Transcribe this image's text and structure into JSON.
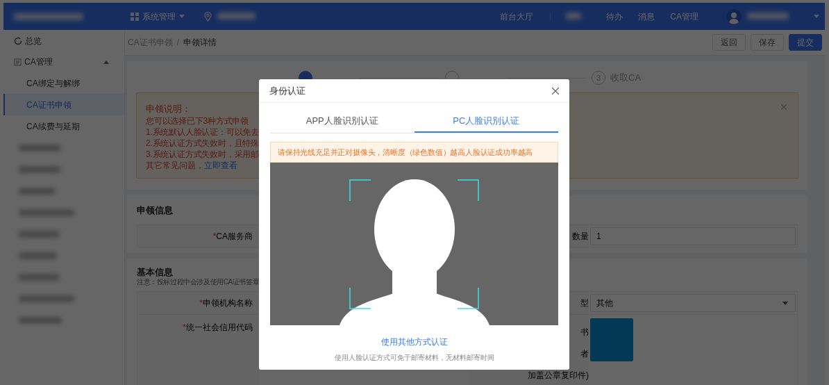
{
  "header": {
    "menu_label": "系统管理",
    "nav": [
      {
        "label": "前台大厅"
      },
      {
        "label": "待办"
      },
      {
        "label": "消息"
      },
      {
        "label": "CA管理"
      }
    ]
  },
  "sidebar": {
    "items": [
      {
        "kind": "link",
        "label": "总览",
        "selected": false
      },
      {
        "kind": "group",
        "label": "CA管理",
        "expanded": true,
        "children": [
          {
            "label": "CA绑定与解绑",
            "selected": false
          },
          {
            "label": "CA证书申领",
            "selected": true
          },
          {
            "label": "CA续费与延期",
            "selected": false
          }
        ]
      }
    ]
  },
  "breadcrumb": [
    "CA证书申领",
    "申领详情"
  ],
  "breadcrumb_separator": "/",
  "actions": [
    {
      "label": "返回",
      "primary": false
    },
    {
      "label": "保存",
      "primary": false
    },
    {
      "label": "提交",
      "primary": true
    }
  ],
  "steps": [
    {
      "active": true
    },
    {
      "active": false
    },
    {
      "number": "3",
      "label": "收取CA",
      "active": false
    }
  ],
  "notice": {
    "title": "申领说明：",
    "lines": [
      "您可以选择已下3种方式申领",
      "1.系统默认人脸认证：可以免去",
      "2.系统认证方式失效时，且特殊",
      "3.系统认证方式失效时，采用邮"
    ],
    "footer": "其它常见问题，",
    "link": "立即查看"
  },
  "apply_info": {
    "title": "申领信息",
    "left_label": "CA服务商",
    "right_label": "数量",
    "right_value": "1"
  },
  "basic_info": {
    "title": "基本信息",
    "note": "注意：投标过程中会涉及使用CA证书签章",
    "row1": {
      "left_label": "申领机构名称",
      "right_label": "型",
      "right_value": "其他"
    },
    "row2": {
      "left_label": "统一社会信用代码",
      "right_label_lines": [
        "书",
        "者",
        "加盖公章复印件)"
      ]
    }
  },
  "required_mark": "*",
  "dialog": {
    "title": "身份认证",
    "tabs": [
      {
        "label": "APP人脸识别认证",
        "selected": false
      },
      {
        "label": "PC人脸识别认证",
        "selected": true
      }
    ],
    "warning": "请保持光线充足并正对摄像头，清晰度（绿色数值）越高人脸认证成功率越高",
    "link": "使用其他方式认证",
    "note": "使用人脸认证方式可免于邮寄材料，无材料邮寄时间"
  }
}
